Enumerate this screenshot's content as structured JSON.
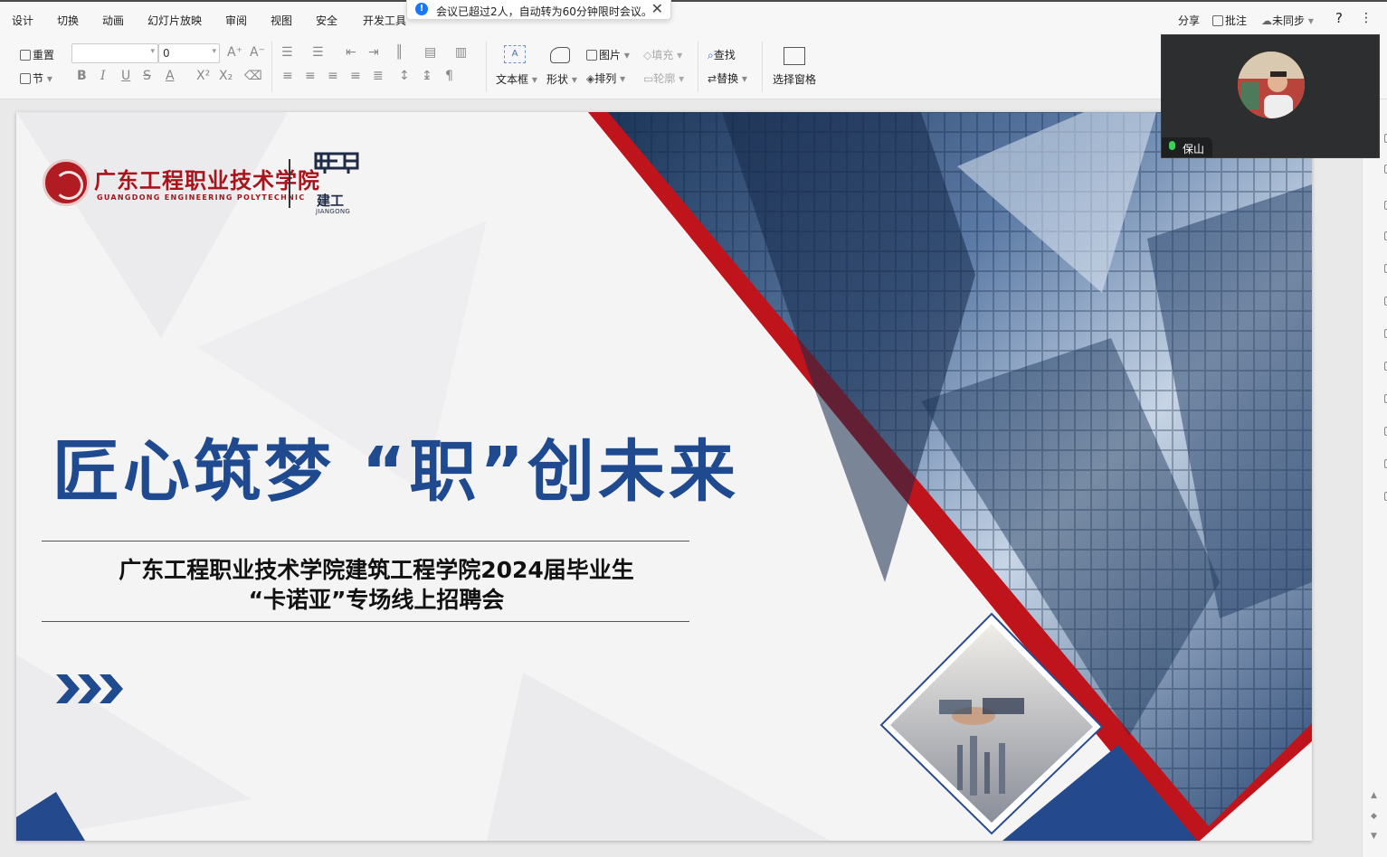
{
  "menu": {
    "items": [
      "设计",
      "切换",
      "动画",
      "幻灯片放映",
      "审阅",
      "视图",
      "安全",
      "开发工具"
    ],
    "right": {
      "share": "分享",
      "comment": "批注",
      "sync": "未同步",
      "help": "?",
      "more": "⋮"
    }
  },
  "toast": {
    "text": "会议已超过2人，自动转为60分钟限时会议。",
    "close": "✕"
  },
  "toolbar": {
    "reset": "重置",
    "section": "节",
    "font_size_value": "0",
    "textbox": "文本框",
    "shape": "形状",
    "picture": "图片",
    "fill": "填充",
    "arrange": "排列",
    "outline": "轮廓",
    "find": "查找",
    "replace": "替换",
    "selection_pane": "选择窗格"
  },
  "slide": {
    "logo_cn": "广东工程职业技术学院",
    "logo_en": "GUANGDONG ENGINEERING POLYTECHNIC",
    "brand_cn": "建工",
    "brand_en": "JIANGONG",
    "title": "匠心筑梦  “职”创未来",
    "subtitle_line1": "广东工程职业技术学院建筑工程学院2024届毕业生",
    "subtitle_line2": "“卡诺亚”专场线上招聘会",
    "colors": {
      "primary": "#1f4a8f",
      "accent": "#c0141c"
    }
  },
  "video": {
    "participant_name": "保山"
  }
}
